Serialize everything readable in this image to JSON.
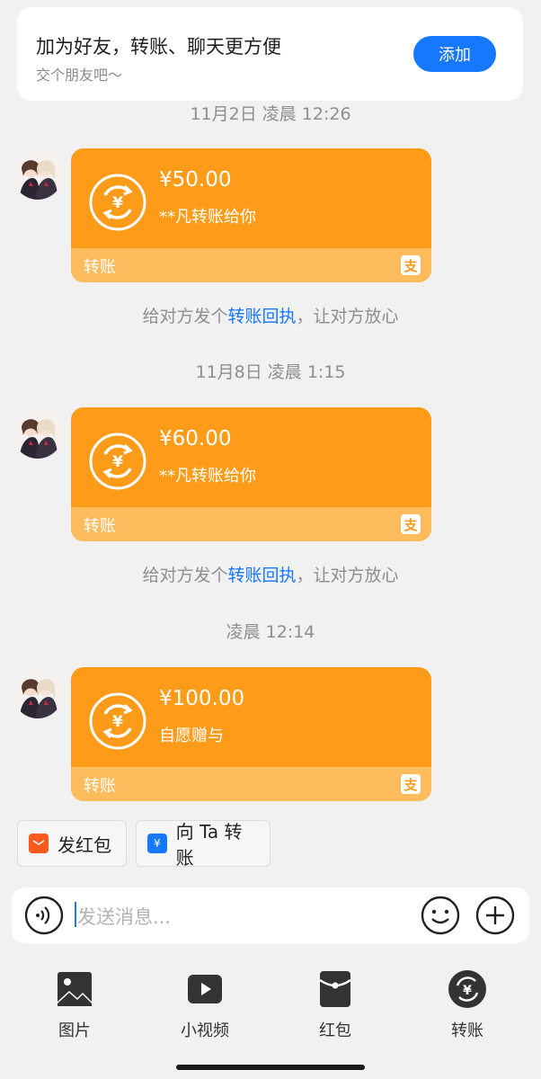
{
  "friend_card": {
    "title": "加为好友，转账、聊天更方便",
    "subtitle": "交个朋友吧～",
    "add_label": "添加",
    "accent": "#1677ff"
  },
  "messages": [
    {
      "timestamp": "11月2日 凌晨 12:26",
      "amount": "¥50.00",
      "note": "**凡转账给你",
      "footer_label": "转账",
      "hint_prefix": "给对方发个",
      "hint_link": "转账回执",
      "hint_suffix": "，让对方放心"
    },
    {
      "timestamp": "11月8日 凌晨 1:15",
      "amount": "¥60.00",
      "note": "**凡转账给你",
      "footer_label": "转账",
      "hint_prefix": "给对方发个",
      "hint_link": "转账回执",
      "hint_suffix": "，让对方放心"
    },
    {
      "timestamp": "凌晨 12:14",
      "amount": "¥100.00",
      "note": "自愿赠与",
      "footer_label": "转账"
    }
  ],
  "quick_actions": {
    "red_packet": "发红包",
    "transfer": "向 Ta 转账"
  },
  "input": {
    "placeholder": "发送消息..."
  },
  "tools": [
    {
      "label": "图片",
      "icon": "image-icon"
    },
    {
      "label": "小视频",
      "icon": "video-icon"
    },
    {
      "label": "红包",
      "icon": "red-packet-icon"
    },
    {
      "label": "转账",
      "icon": "transfer-icon"
    }
  ],
  "colors": {
    "bubble": "#fe9c1a",
    "bubble_footer": "#ffbc5d",
    "link": "#1677ff",
    "red_packet": "#fa5a1e"
  }
}
